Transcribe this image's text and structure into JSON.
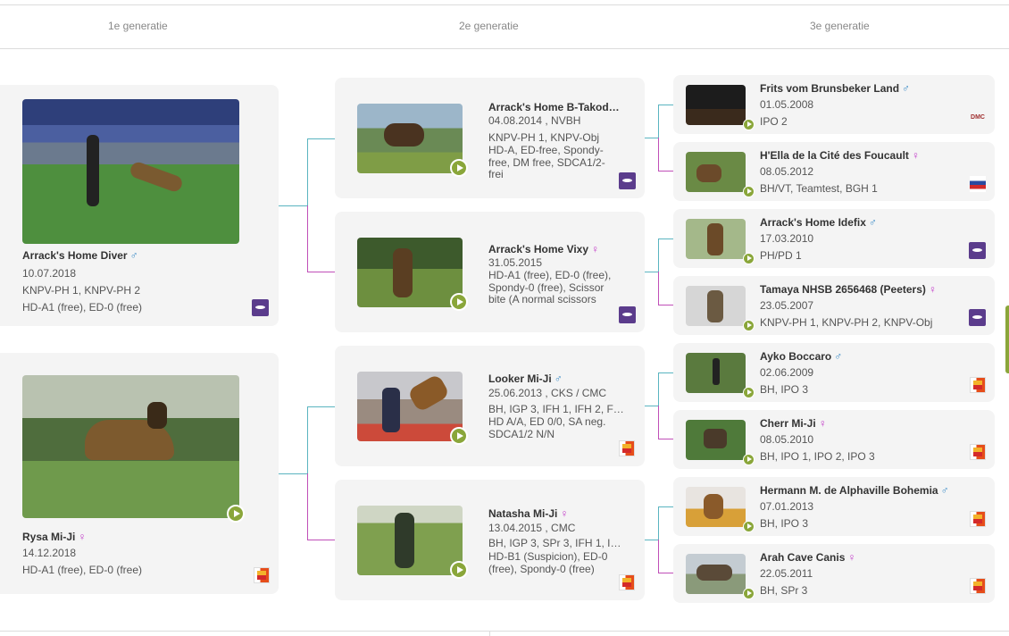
{
  "header": {
    "gen1": "1e generatie",
    "gen2": "2e generatie",
    "gen3": "3e generatie"
  },
  "gen1": [
    {
      "name": "Arrack's Home Diver",
      "sex": "♂",
      "date": "10.07.2018",
      "line1": "KNPV-PH 1, KNPV-PH 2",
      "line2": "HD-A1 (free), ED-0 (free)"
    },
    {
      "name": "Rysa Mi-Ji",
      "sex": "♀",
      "date": "14.12.2018",
      "line1": "HD-A1 (free), ED-0 (free)"
    }
  ],
  "gen2": [
    {
      "name": "Arrack's Home B-Takod…",
      "sex": "",
      "date": "04.08.2014 , NVBH",
      "titles": "KNPV-PH 1, KNPV-Obj",
      "health": "HD-A, ED-free, Spondy-free, DM free, SDCA1/2-frei"
    },
    {
      "name": "Arrack's Home Vixy",
      "sex": "♀",
      "date": "31.05.2015",
      "titles": "",
      "health": "HD-A1 (free), ED-0 (free), Spondy-0 (free), Scissor bite (A normal scissors"
    },
    {
      "name": "Looker Mi-Ji",
      "sex": "♂",
      "date": "25.06.2013 , CKS / CMC",
      "titles": "BH, IGP 3, IFH 1, IFH 2, F…",
      "health": "HD A/A, ED 0/0, SA neg. SDCA1/2 N/N"
    },
    {
      "name": "Natasha Mi-Ji",
      "sex": "♀",
      "date": "13.04.2015 , CMC",
      "titles": "BH, IGP 3, SPr 3, IFH 1, I…",
      "health": "HD-B1 (Suspicion), ED-0 (free), Spondy-0 (free)"
    }
  ],
  "gen3": [
    {
      "name": "Frits vom Brunsbeker Land",
      "sex": "♂",
      "date": "01.05.2008",
      "titles": "IPO 2"
    },
    {
      "name": "H'Ella de la Cité des Foucault",
      "sex": "♀",
      "date": "08.05.2012",
      "titles": "BH/VT, Teamtest, BGH 1"
    },
    {
      "name": "Arrack's Home Idefix",
      "sex": "♂",
      "date": "17.03.2010",
      "titles": "PH/PD 1"
    },
    {
      "name": "Tamaya NHSB 2656468 (Peeters)",
      "sex": "♀",
      "date": "23.05.2007",
      "titles": "KNPV-PH 1, KNPV-PH 2, KNPV-Obj"
    },
    {
      "name": "Ayko Boccaro",
      "sex": "♂",
      "date": "02.06.2009",
      "titles": "BH, IPO 3"
    },
    {
      "name": "Cherr Mi-Ji",
      "sex": "♀",
      "date": "08.05.2010",
      "titles": "BH, IPO 1, IPO 2, IPO 3"
    },
    {
      "name": "Hermann M. de Alphaville Bohemia",
      "sex": "♂",
      "date": "07.01.2013",
      "titles": "BH, IPO 3"
    },
    {
      "name": "Arah Cave Canis",
      "sex": "♀",
      "date": "22.05.2011",
      "titles": "BH, SPr 3"
    }
  ],
  "logos": {
    "dmc": "DMC"
  },
  "colors": {
    "accent_green": "#8aa63a",
    "male_blue": "#3a8bc7",
    "female_pink": "#c23bc8",
    "sire_line": "#5ab4c0",
    "dam_line": "#c04fb8"
  },
  "icons": [
    "play-icon",
    "club-logo-icon",
    "flag-logo-icon"
  ]
}
